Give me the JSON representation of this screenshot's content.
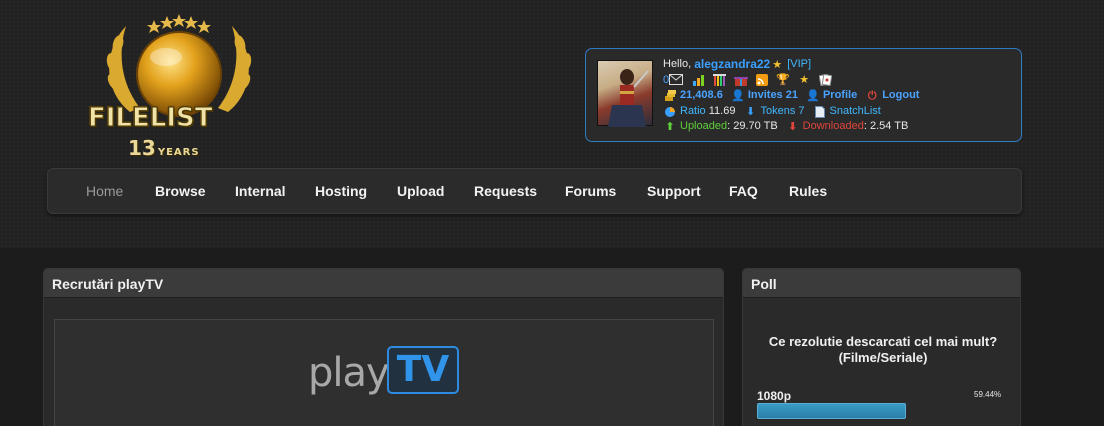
{
  "logo": {
    "brand": "FILELIST",
    "years_number": "13",
    "years_label": "YEARS"
  },
  "user": {
    "greeting": "Hello,",
    "username": "alegzandra22",
    "badge": "[VIP]",
    "messages_count": "0",
    "bonus": "21,408.6",
    "invites_label": "Invites 21",
    "profile_label": "Profile",
    "logout_label": "Logout",
    "ratio_label": "Ratio",
    "ratio_value": "11.69",
    "tokens_label": "Tokens 7",
    "snatchlist_label": "SnatchList",
    "uploaded_label": "Uploaded",
    "uploaded_value": "29.70 TB",
    "downloaded_label": "Downloaded",
    "downloaded_value": "2.54 TB",
    "icons": [
      "envelope-icon",
      "stats-icon",
      "bars-icon",
      "gift-icon",
      "rss-icon",
      "trophy-icon",
      "star-icon",
      "cards-icon"
    ]
  },
  "nav": {
    "items": [
      "Home",
      "Browse",
      "Internal",
      "Hosting",
      "Upload",
      "Requests",
      "Forums",
      "Support",
      "FAQ",
      "Rules"
    ]
  },
  "left_panel": {
    "title": "Recrutări playTV",
    "logo_play": "play",
    "logo_tv": "TV"
  },
  "poll": {
    "title": "Poll",
    "question": "Ce rezolutie descarcati cel mai mult? (Filme/Seriale)",
    "option_label": "1080p",
    "option_percent_text": "59.44%",
    "option_fraction": 0.5944
  },
  "colors": {
    "accent_blue": "#2f7bc4",
    "uploaded_green": "#5fcf3a",
    "downloaded_red": "#e0453a",
    "poll_bar": "#2b7fa8"
  }
}
